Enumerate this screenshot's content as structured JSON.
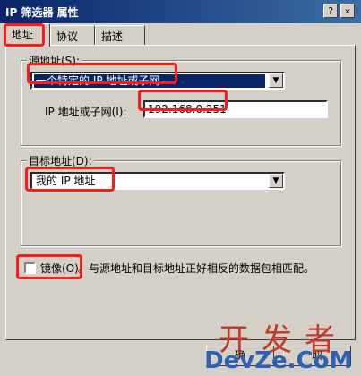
{
  "window": {
    "title": "IP 筛选器 属性",
    "help_btn": "?",
    "close_btn": "×"
  },
  "tabs": [
    {
      "label": "地址",
      "active": true
    },
    {
      "label": "协议",
      "active": false
    },
    {
      "label": "描述",
      "active": false
    }
  ],
  "source": {
    "group_label": "源地址(S):",
    "combo_value": "一个特定的 IP 地址或子网",
    "ip_label": "IP 地址或子网(I):",
    "ip_value": "192.168.0.251"
  },
  "destination": {
    "group_label": "目标地址(D):",
    "combo_value": "我的 IP 地址"
  },
  "mirror": {
    "label": "镜像(O)",
    "description": "。与源地址和目标地址正好相反的数据包相匹配。",
    "checked": false
  },
  "buttons": {
    "ok": "确",
    "cancel": "取"
  },
  "watermark": {
    "line1": "开发者",
    "line2": "DevZe.CoM"
  },
  "colors": {
    "highlight": "#ff1a1a",
    "selection": "#0a246a",
    "dialog": "#d4d0c8"
  }
}
